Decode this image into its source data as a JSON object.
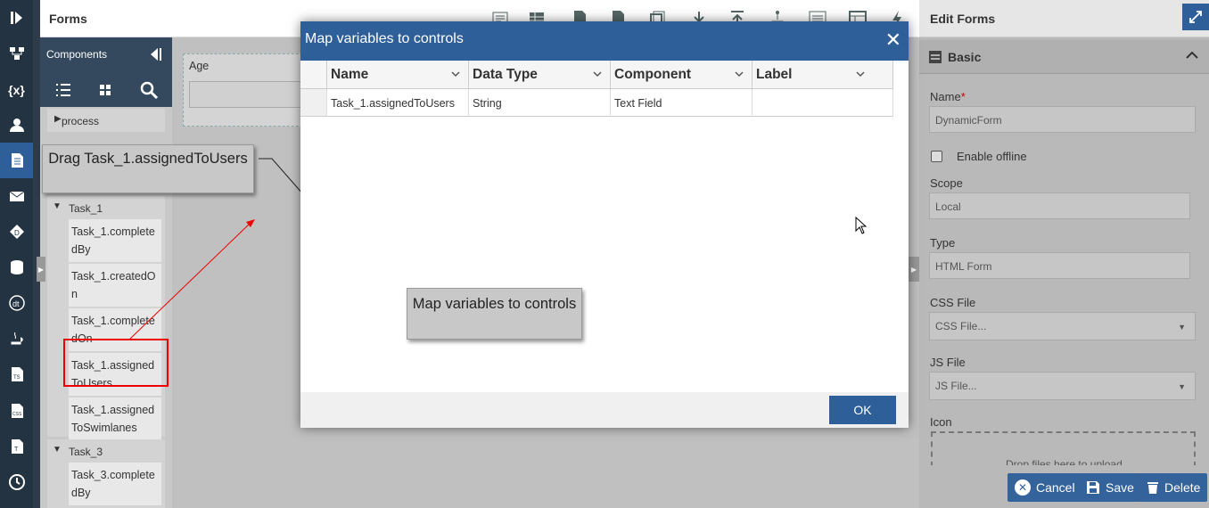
{
  "app": {
    "forms_title": "Forms"
  },
  "rail": {
    "icons": [
      "expand-rail-icon",
      "process-icon",
      "variables-icon",
      "user-icon",
      "forms-icon",
      "mail-icon",
      "decision-icon",
      "database-icon",
      "dt-icon",
      "java-icon",
      "ts-file-icon",
      "css-file-icon",
      "text-file-icon",
      "clock-icon"
    ]
  },
  "components": {
    "title": "Components",
    "tree": [
      {
        "group": "process",
        "items": []
      },
      {
        "group": "Task_1",
        "items": [
          "Task_1.completedBy",
          "Task_1.createdOn",
          "Task_1.completedOn",
          "Task_1.assignedToUsers",
          "Task_1.assignedToSwimlanes"
        ]
      },
      {
        "group": "Task_3",
        "items": [
          "Task_3.completedBy"
        ]
      }
    ]
  },
  "canvas": {
    "field_label": "Age"
  },
  "callouts": {
    "drag": "Drag Task_1.assignedToUsers",
    "map": "Map variables to controls"
  },
  "modal": {
    "title": "Map variables to controls",
    "columns": [
      "Name",
      "Data Type",
      "Component",
      "Label"
    ],
    "rows": [
      {
        "name": "Task_1.assignedToUsers",
        "data_type": "String",
        "component": "Text Field",
        "label": ""
      }
    ],
    "ok_label": "OK"
  },
  "edit_forms": {
    "title": "Edit Forms",
    "section": "Basic",
    "name_label": "Name",
    "name_value": "DynamicForm",
    "offline_label": "Enable offline",
    "scope_label": "Scope",
    "scope_value": "Local",
    "type_label": "Type",
    "type_value": "HTML Form",
    "css_label": "CSS File",
    "css_value": "CSS File...",
    "js_label": "JS File",
    "js_value": "JS File...",
    "icon_label": "Icon",
    "drop_text": "Drop files here to upload",
    "cancel_label": "Cancel",
    "save_label": "Save",
    "delete_label": "Delete"
  },
  "colors": {
    "rail": "#243342",
    "accent": "#2e5f98",
    "highlight": "#ff0000"
  }
}
